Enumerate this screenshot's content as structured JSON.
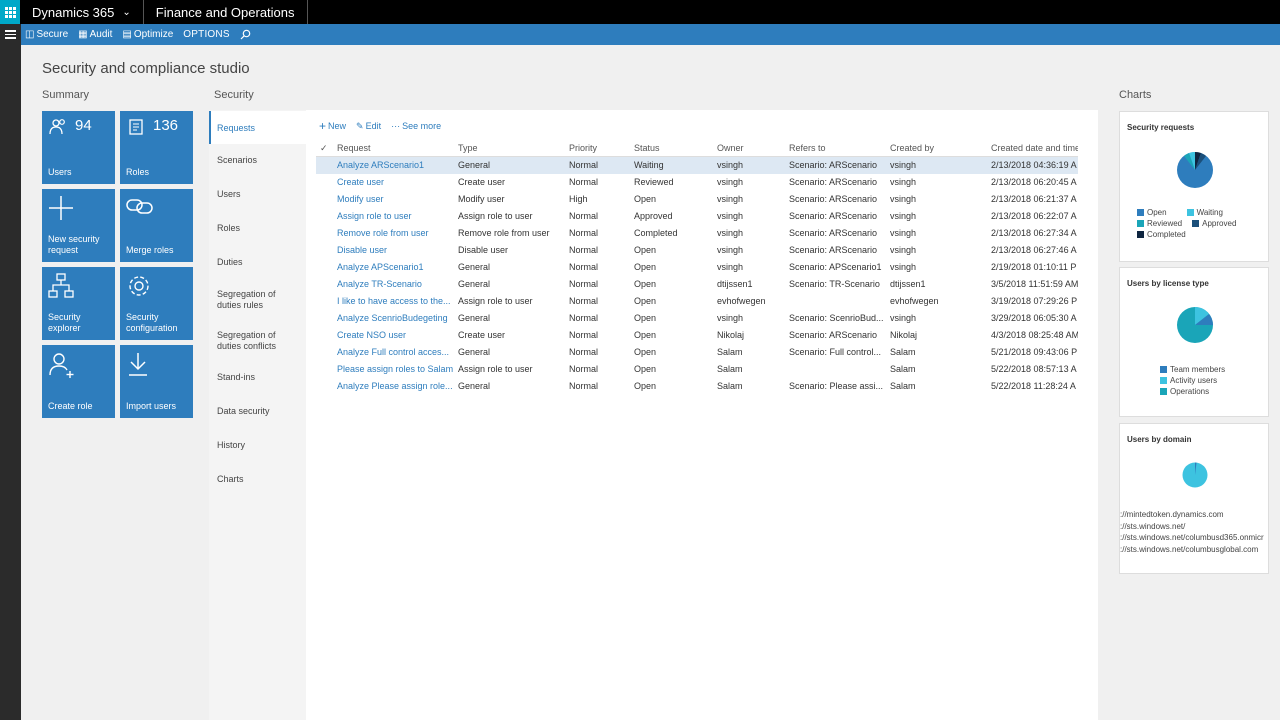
{
  "topbar": {
    "brand": "Dynamics 365",
    "module": "Finance and Operations"
  },
  "actionbar": {
    "secure": "Secure",
    "audit": "Audit",
    "optimize": "Optimize",
    "options": "OPTIONS"
  },
  "page": {
    "title": "Security and compliance studio"
  },
  "summary": {
    "label": "Summary",
    "tiles": [
      {
        "label": "Users",
        "count": "94",
        "icon": "users-icon"
      },
      {
        "label": "Roles",
        "count": "136",
        "icon": "roles-icon"
      },
      {
        "label": "New security request",
        "icon": "plus-icon"
      },
      {
        "label": "Merge roles",
        "icon": "link-icon"
      },
      {
        "label": "Security explorer",
        "icon": "hierarchy-icon"
      },
      {
        "label": "Security configuration",
        "icon": "gear-icon"
      },
      {
        "label": "Create role",
        "icon": "add-person-icon"
      },
      {
        "label": "Import users",
        "icon": "download-icon"
      }
    ]
  },
  "security": {
    "label": "Security",
    "tabs": [
      "Requests",
      "Scenarios",
      "Users",
      "Roles",
      "Duties",
      "Segregation of duties rules",
      "Segregation of duties conflicts",
      "Stand-ins",
      "Data security",
      "History",
      "Charts"
    ]
  },
  "toolbar": {
    "new": "New",
    "edit": "Edit",
    "see_more": "See more"
  },
  "grid": {
    "headers": [
      "Request",
      "Type",
      "Priority",
      "Status",
      "Owner",
      "Refers to",
      "Created by",
      "Created date and time"
    ],
    "rows": [
      [
        "Analyze ARScenario1",
        "General",
        "Normal",
        "Waiting",
        "vsingh",
        "Scenario: ARScenario",
        "vsingh",
        "2/13/2018 04:36:19 A"
      ],
      [
        "Create user",
        "Create user",
        "Normal",
        "Reviewed",
        "vsingh",
        "Scenario: ARScenario",
        "vsingh",
        "2/13/2018 06:20:45 A"
      ],
      [
        "Modify user",
        "Modify user",
        "High",
        "Open",
        "vsingh",
        "Scenario: ARScenario",
        "vsingh",
        "2/13/2018 06:21:37 A"
      ],
      [
        "Assign role to user",
        "Assign role to user",
        "Normal",
        "Approved",
        "vsingh",
        "Scenario: ARScenario",
        "vsingh",
        "2/13/2018 06:22:07 A"
      ],
      [
        "Remove role from user",
        "Remove role from user",
        "Normal",
        "Completed",
        "vsingh",
        "Scenario: ARScenario",
        "vsingh",
        "2/13/2018 06:27:34 A"
      ],
      [
        "Disable user",
        "Disable user",
        "Normal",
        "Open",
        "vsingh",
        "Scenario: ARScenario",
        "vsingh",
        "2/13/2018 06:27:46 A"
      ],
      [
        "Analyze APScenario1",
        "General",
        "Normal",
        "Open",
        "vsingh",
        "Scenario: APScenario1",
        "vsingh",
        "2/19/2018 01:10:11 P"
      ],
      [
        "Analyze TR-Scenario",
        "General",
        "Normal",
        "Open",
        "dtijssen1",
        "Scenario: TR-Scenario",
        "dtijssen1",
        "3/5/2018 11:51:59 AM"
      ],
      [
        "I like to have access to the...",
        "Assign role to user",
        "Normal",
        "Open",
        "evhofwegen",
        "",
        "evhofwegen",
        "3/19/2018 07:29:26 P"
      ],
      [
        "Analyze ScenrioBudegeting",
        "General",
        "Normal",
        "Open",
        "vsingh",
        "Scenario: ScenrioBud...",
        "vsingh",
        "3/29/2018 06:05:30 A"
      ],
      [
        "Create NSO user",
        "Create user",
        "Normal",
        "Open",
        "Nikolaj",
        "Scenario: ARScenario",
        "Nikolaj",
        "4/3/2018 08:25:48 AM"
      ],
      [
        "Analyze Full control acces...",
        "General",
        "Normal",
        "Open",
        "Salam",
        "Scenario: Full control...",
        "Salam",
        "5/21/2018 09:43:06 P"
      ],
      [
        "Please assign roles to Salam",
        "Assign role to user",
        "Normal",
        "Open",
        "Salam",
        "",
        "Salam",
        "5/22/2018 08:57:13 A"
      ],
      [
        "Analyze Please assign role...",
        "General",
        "Normal",
        "Open",
        "Salam",
        "Scenario: Please assi...",
        "Salam",
        "5/22/2018 11:28:24 A"
      ]
    ]
  },
  "charts": {
    "label": "Charts",
    "security_requests": {
      "title": "Security requests",
      "legend": [
        {
          "label": "Open",
          "color": "#2e7dbd"
        },
        {
          "label": "Waiting",
          "color": "#3dc3e0"
        },
        {
          "label": "Reviewed",
          "color": "#1aa5b8"
        },
        {
          "label": "Approved",
          "color": "#1b4f7a"
        },
        {
          "label": "Completed",
          "color": "#0e2540"
        }
      ]
    },
    "license": {
      "title": "Users by license type",
      "legend": [
        {
          "label": "Team members",
          "color": "#2e7dbd"
        },
        {
          "label": "Activity users",
          "color": "#3dc3e0"
        },
        {
          "label": "Operations",
          "color": "#1aa5b8"
        }
      ]
    },
    "domain": {
      "title": "Users by domain",
      "domains": [
        "://mintedtoken.dynamics.com",
        "://sts.windows.net/",
        "://sts.windows.net/columbusd365.onmicr",
        "://sts.windows.net/columbusglobal.com"
      ]
    }
  }
}
